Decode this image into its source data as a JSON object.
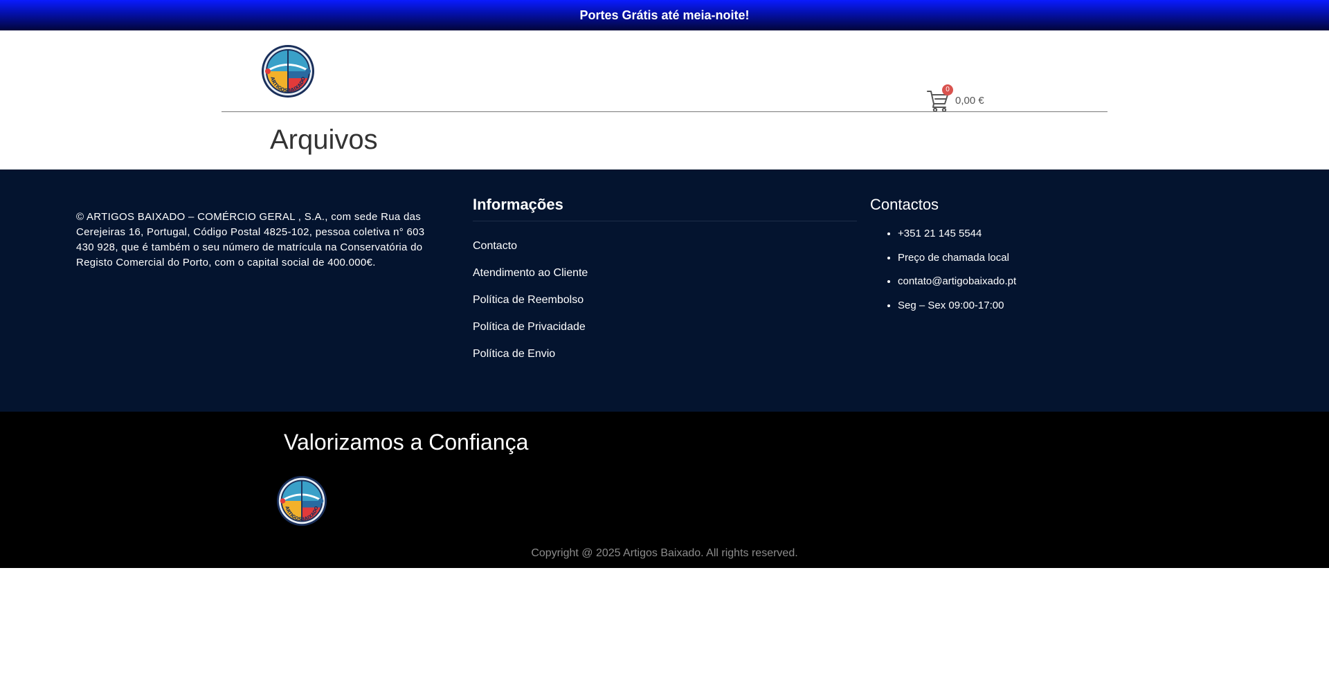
{
  "promo": {
    "text": "Portes Grátis até meia-noite!"
  },
  "header": {
    "logo_text": "ARTIGOSBAIXADO",
    "cart": {
      "count": "0",
      "total": "0,00 €"
    }
  },
  "page": {
    "title": "Arquivos"
  },
  "footer": {
    "company_info": "© ARTIGOS BAIXADO – COMÉRCIO GERAL , S.A., com sede Rua das Cerejeiras 16, Portugal, Código Postal 4825-102, pessoa coletiva n° 603 430 928, que é também o seu número de matrícula na Conservatória do Registo Comercial do Porto, com o capital social de 400.000€.",
    "info": {
      "title": "Informações",
      "links": [
        "Contacto",
        "Atendimento ao Cliente",
        "Política de Reembolso",
        "Política de Privacidade",
        "Política de Envio"
      ]
    },
    "contacts": {
      "title": "Contactos",
      "items": [
        "+351 21 145 5544",
        "Preço de chamada local",
        "contato@artigobaixado.pt",
        "Seg – Sex 09:00-17:00"
      ]
    },
    "trust_title": "Valorizamos a Confiança",
    "copyright": "Copyright @ 2025 Artigos Baixado. All rights reserved."
  },
  "colors": {
    "promo_top": "#0a1bff",
    "promo_bottom": "#02053a",
    "footer_main_bg": "#04142f",
    "footer_bottom_bg": "#000000",
    "cart_badge": "#d9534f"
  },
  "icons": {
    "cart": "shopping-cart-icon",
    "logo": "artigos-baixado-logo"
  }
}
